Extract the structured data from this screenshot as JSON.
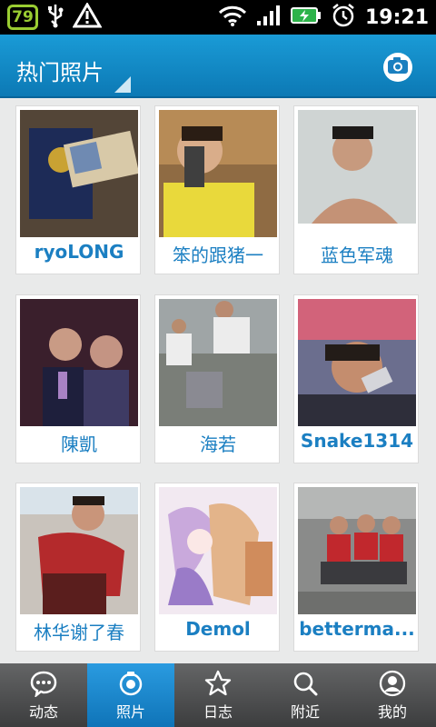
{
  "status_bar": {
    "battery_level": "79",
    "time": "19:21"
  },
  "header": {
    "title": "热门照片"
  },
  "photos": [
    {
      "name": "ryoLONG",
      "bold": true
    },
    {
      "name": "笨的跟猪一",
      "bold": false
    },
    {
      "name": "蓝色军魂",
      "bold": false
    },
    {
      "name": "陳凱",
      "bold": false
    },
    {
      "name": "海若",
      "bold": false
    },
    {
      "name": "Snake1314",
      "bold": true
    },
    {
      "name": "林华谢了春",
      "bold": false
    },
    {
      "name": "Demol",
      "bold": true
    },
    {
      "name": "betterma...",
      "bold": true
    }
  ],
  "nav": {
    "items": [
      {
        "label": "动态",
        "icon": "chat-bubble-icon"
      },
      {
        "label": "照片",
        "icon": "photos-icon"
      },
      {
        "label": "日志",
        "icon": "star-icon"
      },
      {
        "label": "附近",
        "icon": "search-icon"
      },
      {
        "label": "我的",
        "icon": "profile-icon"
      }
    ],
    "active_index": 1
  },
  "colors": {
    "accent": "#1b7fc2",
    "header": "#1a9bd6",
    "nav_active": "#2a9be0"
  }
}
